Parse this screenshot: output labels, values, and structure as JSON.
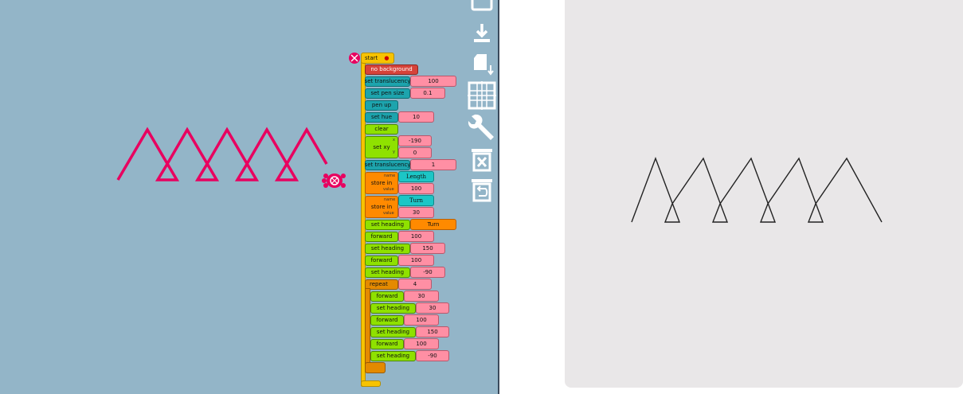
{
  "blocks": {
    "start": "start",
    "no_background": "no background",
    "set_translucency": "set translucency",
    "set_translucency_value": "100",
    "set_pen_size": "set pen size",
    "set_pen_size_value": "0.1",
    "pen_up": "pen up",
    "set_hue": "set hue",
    "set_hue_value": "10",
    "clear": "clear",
    "set_xy": "set xy",
    "set_xy_x_label": "x",
    "set_xy_y_label": "y",
    "set_xy_x": "-190",
    "set_xy_y": "0",
    "set_translucency_2": "set translucency",
    "set_translucency_2_value": "1",
    "store_in_1": "store in",
    "store_in_1_name_label": "name",
    "store_in_1_value_label": "value",
    "store_in_1_name": "Length",
    "store_in_1_value": "100",
    "store_in_2": "store in",
    "store_in_2_name_label": "name",
    "store_in_2_value_label": "value",
    "store_in_2_name": "Turn",
    "store_in_2_value": "30",
    "set_heading_turn": "set heading",
    "set_heading_turn_value": "Turn",
    "forward_1": "forward",
    "forward_1_value": "100",
    "set_heading_150": "set heading",
    "set_heading_150_value": "150",
    "forward_2": "forward",
    "forward_2_value": "100",
    "set_heading_m90": "set heading",
    "set_heading_m90_value": "-90",
    "repeat": "repeat",
    "repeat_value": "4",
    "inner_forward_1": "forward",
    "inner_forward_1_value": "30",
    "inner_set_heading_1": "set heading",
    "inner_set_heading_1_value": "30",
    "inner_forward_2": "forward",
    "inner_forward_2_value": "100",
    "inner_set_heading_2": "set heading",
    "inner_set_heading_2_value": "150",
    "inner_forward_3": "forward",
    "inner_forward_3_value": "100",
    "inner_set_heading_3": "set heading",
    "inner_set_heading_3_value": "-90"
  },
  "toolbar": {
    "icons": [
      "run-icon",
      "save-icon",
      "save-as-icon",
      "grid-icon",
      "settings-wrench-icon",
      "clear-delete-icon",
      "restore-trash-icon"
    ]
  },
  "colors": {
    "canvas_background": "#93b5c8",
    "pen_color": "#e8005f",
    "preview_stroke": "#222222",
    "preview_background": "#e9e7e8"
  }
}
